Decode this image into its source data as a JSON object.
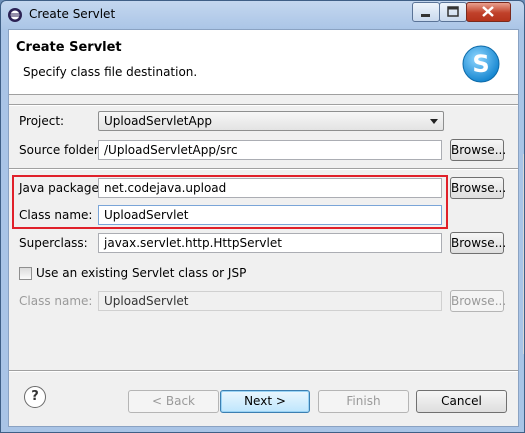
{
  "window": {
    "title": "Create Servlet"
  },
  "header": {
    "title": "Create Servlet",
    "description": "Specify class file destination."
  },
  "form": {
    "project": {
      "label": "Project:",
      "value": "UploadServletApp"
    },
    "source_folder": {
      "label": "Source folder:",
      "value": "/UploadServletApp/src",
      "browse": "Browse..."
    },
    "java_package": {
      "label": "Java package:",
      "value": "net.codejava.upload",
      "browse": "Browse..."
    },
    "class_name": {
      "label": "Class name:",
      "value": "UploadServlet"
    },
    "superclass": {
      "label": "Superclass:",
      "value": "javax.servlet.http.HttpServlet",
      "browse": "Browse..."
    },
    "use_existing": {
      "label": "Use an existing Servlet class or JSP",
      "checked": false
    },
    "existing_class_name": {
      "label": "Class name:",
      "value": "UploadServlet",
      "browse": "Browse..."
    }
  },
  "footer": {
    "help": "?",
    "back": "< Back",
    "next": "Next >",
    "finish": "Finish",
    "cancel": "Cancel"
  },
  "colors": {
    "highlight": "#e0202a",
    "logo": "#2aa0e0"
  },
  "icons": {
    "window": "eclipse-icon",
    "logo": "servlet-s-icon",
    "help": "help-icon"
  }
}
